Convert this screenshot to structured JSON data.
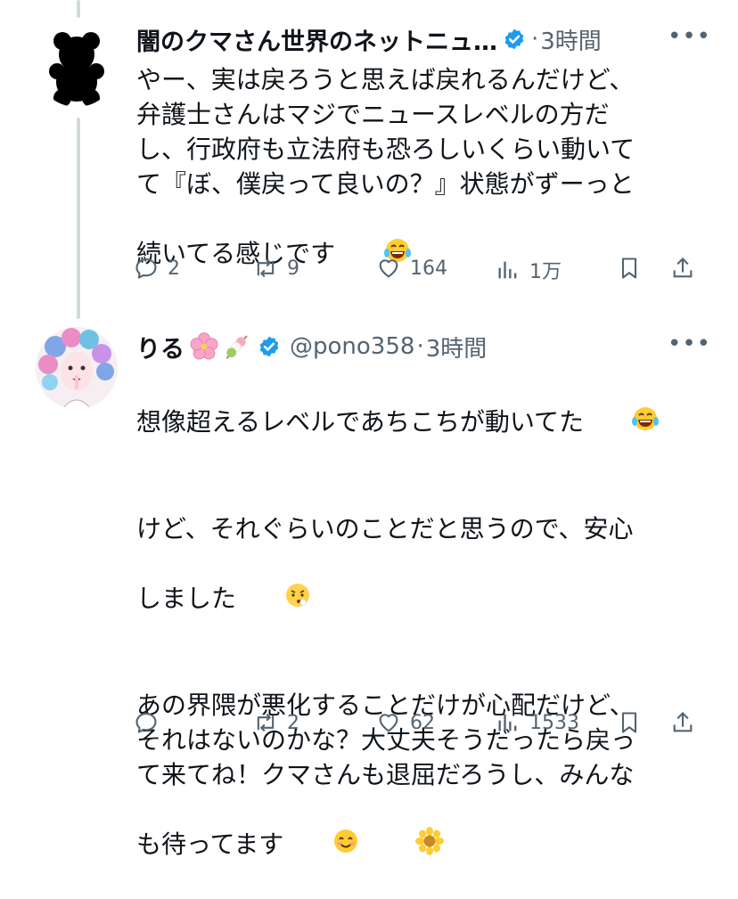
{
  "tweets": [
    {
      "author": "闇のクマさん世界のネットニュ…",
      "handle": "",
      "time": "3時間",
      "avatar_icon": "bear-silhouette",
      "verified": true,
      "body": "やー、実は戻ろうと思えば戻れるんだけど、\n弁護士さんはマジでニュースレベルの方だ\nし、行政府も立法府も恐ろしいくらい動いて\nて『ぼ、僕戻って良いの？』状態がずーっと\n続いてる感じです",
      "body_emoji": "laughing-tears-emoji",
      "stats": {
        "replies": "2",
        "reposts": "9",
        "likes": "164",
        "views": "1万"
      }
    },
    {
      "author": "りる",
      "name_emojis": [
        "cherry-blossom-emoji",
        "dango-emoji"
      ],
      "handle": "@pono358",
      "time": "3時間",
      "avatar_icon": "illustrated-girl-avatar",
      "verified": true,
      "body_p1": "想像超えるレベルであちこちが動いてた",
      "body_p2": "けど、それぐらいのことだと思うので、安心\nしました",
      "body_p3": "あの界隈が悪化することだけが心配だけど、\nそれはないのかな？大丈夫そうだったら戻っ\nて来てね！クマさんも退屈だろうし、みんな\nも待ってます",
      "stats": {
        "replies": "",
        "reposts": "2",
        "likes": "62",
        "views": "1533"
      }
    }
  ],
  "colors": {
    "accent": "#1d9bf0",
    "muted": "#536471",
    "text": "#0f1419",
    "line": "#cfd9de"
  }
}
